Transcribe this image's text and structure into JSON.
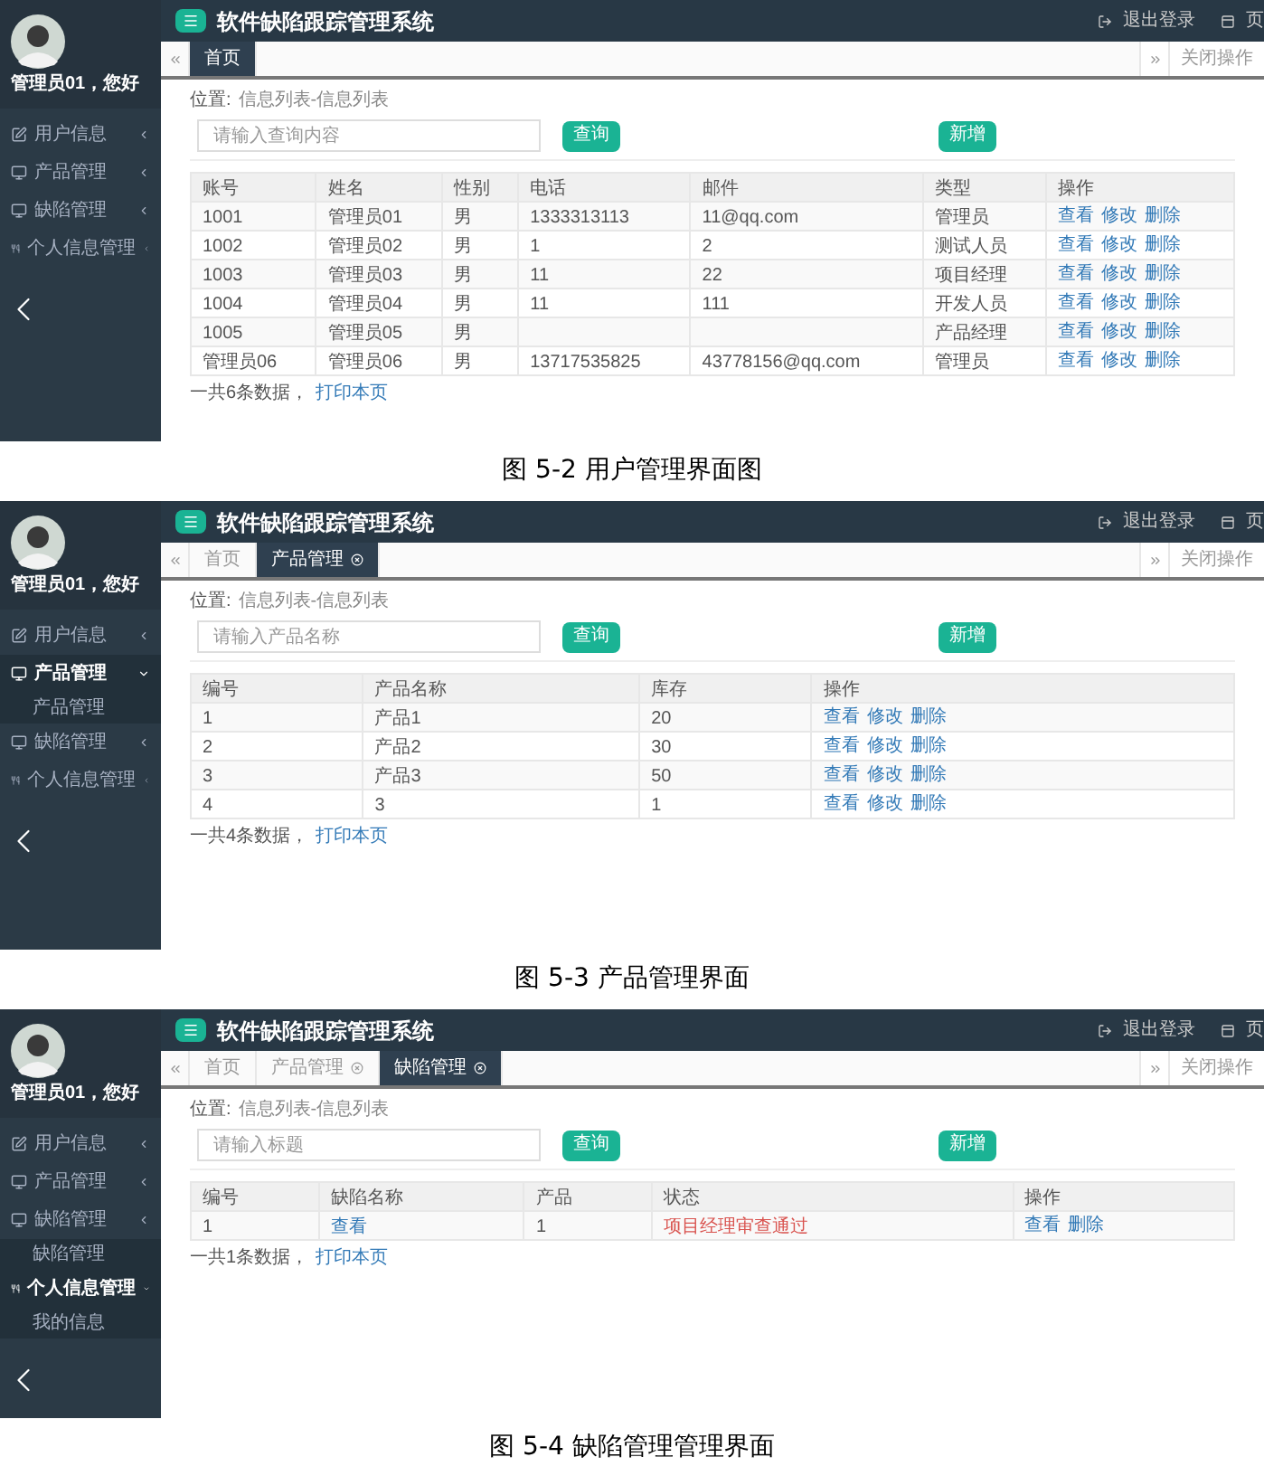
{
  "figures": [
    {
      "screen": {
        "title": "软件缺陷跟踪管理系统",
        "greeting": "管理员01，您好",
        "logout": "退出登录",
        "page_menu": "页",
        "close_ops": "关闭操作",
        "sidebar": [
          {
            "label": "用户信息",
            "kind": "edit",
            "expanded": false
          },
          {
            "label": "产品管理",
            "kind": "monitor",
            "expanded": false
          },
          {
            "label": "缺陷管理",
            "kind": "monitor",
            "expanded": false
          },
          {
            "label": "个人信息管理",
            "kind": "cutlery",
            "expanded": false
          }
        ],
        "tabs": [
          {
            "label": "首页",
            "selected": true,
            "closable": false
          }
        ],
        "location_label": "位置:",
        "location_path": "信息列表-信息列表",
        "search": {
          "placeholder": "请输入查询内容"
        },
        "query_button": "查询",
        "add_button": "新增",
        "columns": [
          {
            "label": "账号",
            "kind": "text"
          },
          {
            "label": "姓名",
            "kind": "text"
          },
          {
            "label": "性别",
            "kind": "text"
          },
          {
            "label": "电话",
            "kind": "text"
          },
          {
            "label": "邮件",
            "kind": "text"
          },
          {
            "label": "类型",
            "kind": "text"
          },
          {
            "label": "操作",
            "kind": "actions"
          }
        ],
        "rows": [
          [
            "1001",
            "管理员01",
            "男",
            "1333313113",
            "11@qq.com",
            "管理员",
            [
              "查看",
              "修改",
              "删除"
            ]
          ],
          [
            "1002",
            "管理员02",
            "男",
            "1",
            "2",
            "测试人员",
            [
              "查看",
              "修改",
              "删除"
            ]
          ],
          [
            "1003",
            "管理员03",
            "男",
            "11",
            "22",
            "项目经理",
            [
              "查看",
              "修改",
              "删除"
            ]
          ],
          [
            "1004",
            "管理员04",
            "男",
            "11",
            "111",
            "开发人员",
            [
              "查看",
              "修改",
              "删除"
            ]
          ],
          [
            "1005",
            "管理员05",
            "男",
            "",
            "",
            "产品经理",
            [
              "查看",
              "修改",
              "删除"
            ]
          ],
          [
            "管理员06",
            "管理员06",
            "男",
            "13717535825",
            "43778156@qq.com",
            "管理员",
            [
              "查看",
              "修改",
              "删除"
            ]
          ]
        ],
        "count_text": "一共6条数据，",
        "print_link": "打印本页"
      },
      "caption": "图 5-2 用户管理界面图"
    },
    {
      "screen": {
        "title": "软件缺陷跟踪管理系统",
        "greeting": "管理员01，您好",
        "logout": "退出登录",
        "page_menu": "页",
        "close_ops": "关闭操作",
        "sidebar": [
          {
            "label": "用户信息",
            "kind": "edit",
            "expanded": false
          },
          {
            "label": "产品管理",
            "kind": "monitor",
            "expanded": true,
            "children": [
              {
                "label": "产品管理"
              }
            ]
          },
          {
            "label": "缺陷管理",
            "kind": "monitor",
            "expanded": false
          },
          {
            "label": "个人信息管理",
            "kind": "cutlery",
            "expanded": false
          }
        ],
        "tabs": [
          {
            "label": "首页",
            "selected": false,
            "closable": false
          },
          {
            "label": "产品管理",
            "selected": true,
            "closable": true
          }
        ],
        "location_label": "位置:",
        "location_path": "信息列表-信息列表",
        "search": {
          "placeholder": "请输入产品名称"
        },
        "query_button": "查询",
        "add_button": "新增",
        "columns": [
          {
            "label": "编号",
            "kind": "text"
          },
          {
            "label": "产品名称",
            "kind": "text"
          },
          {
            "label": "库存",
            "kind": "text"
          },
          {
            "label": "操作",
            "kind": "actions"
          }
        ],
        "rows": [
          [
            "1",
            "产品1",
            "20",
            [
              "查看",
              "修改",
              "删除"
            ]
          ],
          [
            "2",
            "产品2",
            "30",
            [
              "查看",
              "修改",
              "删除"
            ]
          ],
          [
            "3",
            "产品3",
            "50",
            [
              "查看",
              "修改",
              "删除"
            ]
          ],
          [
            "4",
            "3",
            "1",
            [
              "查看",
              "修改",
              "删除"
            ]
          ]
        ],
        "count_text": "一共4条数据，",
        "print_link": "打印本页"
      },
      "caption": "图 5-3 产品管理界面"
    },
    {
      "screen": {
        "title": "软件缺陷跟踪管理系统",
        "greeting": "管理员01，您好",
        "logout": "退出登录",
        "page_menu": "页",
        "close_ops": "关闭操作",
        "sidebar": [
          {
            "label": "用户信息",
            "kind": "edit",
            "expanded": false
          },
          {
            "label": "产品管理",
            "kind": "monitor",
            "expanded": false
          },
          {
            "label": "缺陷管理",
            "kind": "monitor",
            "expanded": false,
            "children": [
              {
                "label": "缺陷管理"
              }
            ]
          },
          {
            "label": "个人信息管理",
            "kind": "cutlery",
            "expanded": true,
            "children": [
              {
                "label": "我的信息"
              }
            ]
          }
        ],
        "tabs": [
          {
            "label": "首页",
            "selected": false,
            "closable": false
          },
          {
            "label": "产品管理",
            "selected": false,
            "closable": true
          },
          {
            "label": "缺陷管理",
            "selected": true,
            "closable": true
          }
        ],
        "location_label": "位置:",
        "location_path": "信息列表-信息列表",
        "search": {
          "placeholder": "请输入标题"
        },
        "query_button": "查询",
        "add_button": "新增",
        "columns": [
          {
            "label": "编号",
            "kind": "text"
          },
          {
            "label": "缺陷名称",
            "kind": "link"
          },
          {
            "label": "产品",
            "kind": "text"
          },
          {
            "label": "状态",
            "kind": "alert"
          },
          {
            "label": "操作",
            "kind": "actions"
          }
        ],
        "rows": [
          [
            "1",
            "查看",
            "1",
            "项目经理审查通过",
            [
              "查看",
              "删除"
            ]
          ]
        ],
        "count_text": "一共1条数据，",
        "print_link": "打印本页"
      },
      "caption": "图 5-4 缺陷管理管理界面"
    }
  ]
}
